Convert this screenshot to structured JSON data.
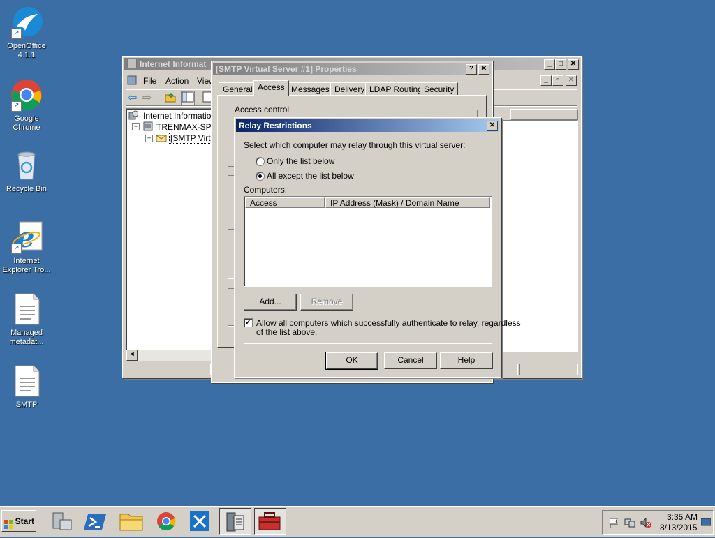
{
  "desktop": {
    "icons": [
      {
        "label": "OpenOffice 4.1.1",
        "icon": "openoffice-icon"
      },
      {
        "label": "Google Chrome",
        "icon": "chrome-icon"
      },
      {
        "label": "Recycle Bin",
        "icon": "recycle-bin-icon"
      },
      {
        "label": "Internet Explorer Tro...",
        "icon": "ie-icon"
      },
      {
        "label": "Managed metadat...",
        "icon": "document-icon"
      },
      {
        "label": "SMTP",
        "icon": "document-icon"
      }
    ]
  },
  "iis_window": {
    "title": "Internet Informat",
    "menu": {
      "file": "File",
      "action": "Action",
      "view": "View"
    },
    "tree": {
      "root": "Internet Information",
      "server": "TRENMAX-SP (lo",
      "smtp": "[SMTP Virtua"
    }
  },
  "props_dialog": {
    "title": "[SMTP Virtual Server #1] Properties",
    "tabs": [
      "General",
      "Access",
      "Messages",
      "Delivery",
      "LDAP Routing",
      "Security"
    ],
    "selected_tab": "Access",
    "group_access_control": "Access control"
  },
  "relay_dialog": {
    "title": "Relay Restrictions",
    "prompt": "Select which computer may relay through this virtual server:",
    "radio_only": "Only the list below",
    "radio_all_except": "All except the list below",
    "radio_selected": "all_except",
    "computers_label": "Computers:",
    "columns": [
      "Access",
      "IP Address (Mask) / Domain Name"
    ],
    "rows": [],
    "add_label": "Add...",
    "remove_label": "Remove",
    "allow_auth_label_line1": "Allow all computers which successfully authenticate to relay, regardless",
    "allow_auth_label_line2": "of the list above.",
    "allow_auth_checked": true,
    "ok_label": "OK",
    "cancel_label": "Cancel",
    "help_label": "Help"
  },
  "taskbar": {
    "start_label": "Start",
    "apps": [
      "server-manager-icon",
      "powershell-icon",
      "explorer-folder-icon",
      "chrome-icon",
      "tools-icon",
      "iis-icon",
      "toolbox-icon"
    ],
    "clock_time": "3:35 AM",
    "clock_date": "8/13/2015"
  },
  "colors": {
    "desktop": "#3a6ea5",
    "title_active": "#0a246a",
    "face": "#d4d0c8"
  }
}
